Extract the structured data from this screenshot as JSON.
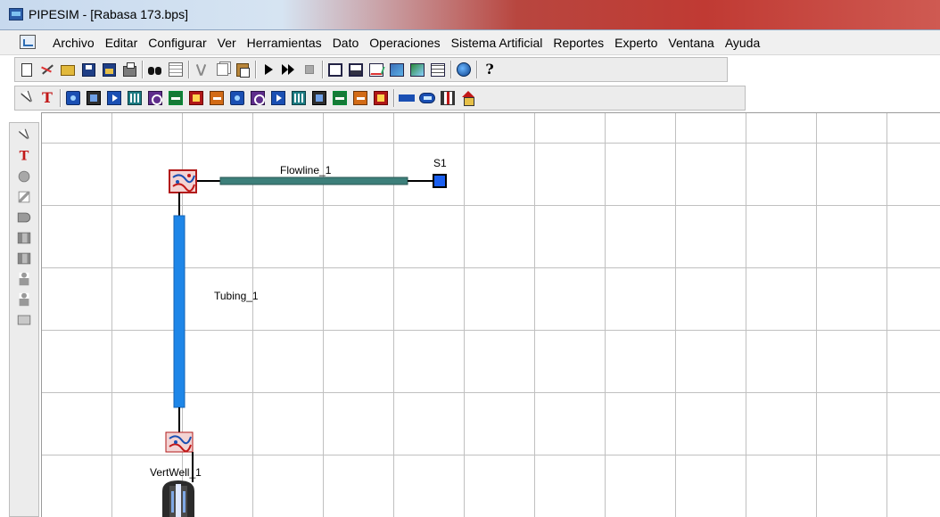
{
  "window": {
    "title": "PIPESIM - [Rabasa 173.bps]"
  },
  "menu": {
    "items": [
      "Archivo",
      "Editar",
      "Configurar",
      "Ver",
      "Herramientas",
      "Dato",
      "Operaciones",
      "Sistema Artificial",
      "Reportes",
      "Experto",
      "Ventana",
      "Ayuda"
    ]
  },
  "toolbar1": {
    "icons": [
      "new-icon",
      "line-tool-icon",
      "open-icon",
      "save-icon",
      "save-as-icon",
      "print-icon",
      "find-icon",
      "grid-icon",
      "cut-icon",
      "copy-icon",
      "paste-icon",
      "run-icon",
      "run-all-icon",
      "stop-icon",
      "window-icon",
      "window-split-icon",
      "chart-icon",
      "chart-surface-icon",
      "chart-profile-icon",
      "table-icon",
      "globe-icon",
      "help-icon"
    ]
  },
  "toolbar2": {
    "icons": [
      "pointer-icon",
      "text-icon",
      "source-icon",
      "well-icon",
      "arrow-icon",
      "separator-icon",
      "compressor-icon",
      "pump-icon",
      "heater-icon",
      "valve-icon",
      "choke-icon",
      "multiplier-icon",
      "injection-icon",
      "nodal-icon",
      "expander-icon",
      "report-icon",
      "junction-icon",
      "sink-icon",
      "connector-icon",
      "pipe-icon",
      "bars-icon",
      "house-icon"
    ]
  },
  "palette": {
    "icons": [
      "pointer-icon",
      "text-icon",
      "source-node-icon",
      "flowline-tool-icon",
      "tubing-tool-icon",
      "well-production-icon",
      "well-injection-icon",
      "person-icon",
      "miscellaneous-icon",
      "box-icon"
    ]
  },
  "network": {
    "flowline_label": "Flowline_1",
    "sink_label": "S1",
    "tubing_label": "Tubing_1",
    "well_label": "VertWell_1"
  },
  "colors": {
    "flowline": "#3d7f7a",
    "tubing": "#1e86e8",
    "sink": "#1a5ff0",
    "node_border": "#b21a1a",
    "grid": "#c0c0c0"
  }
}
